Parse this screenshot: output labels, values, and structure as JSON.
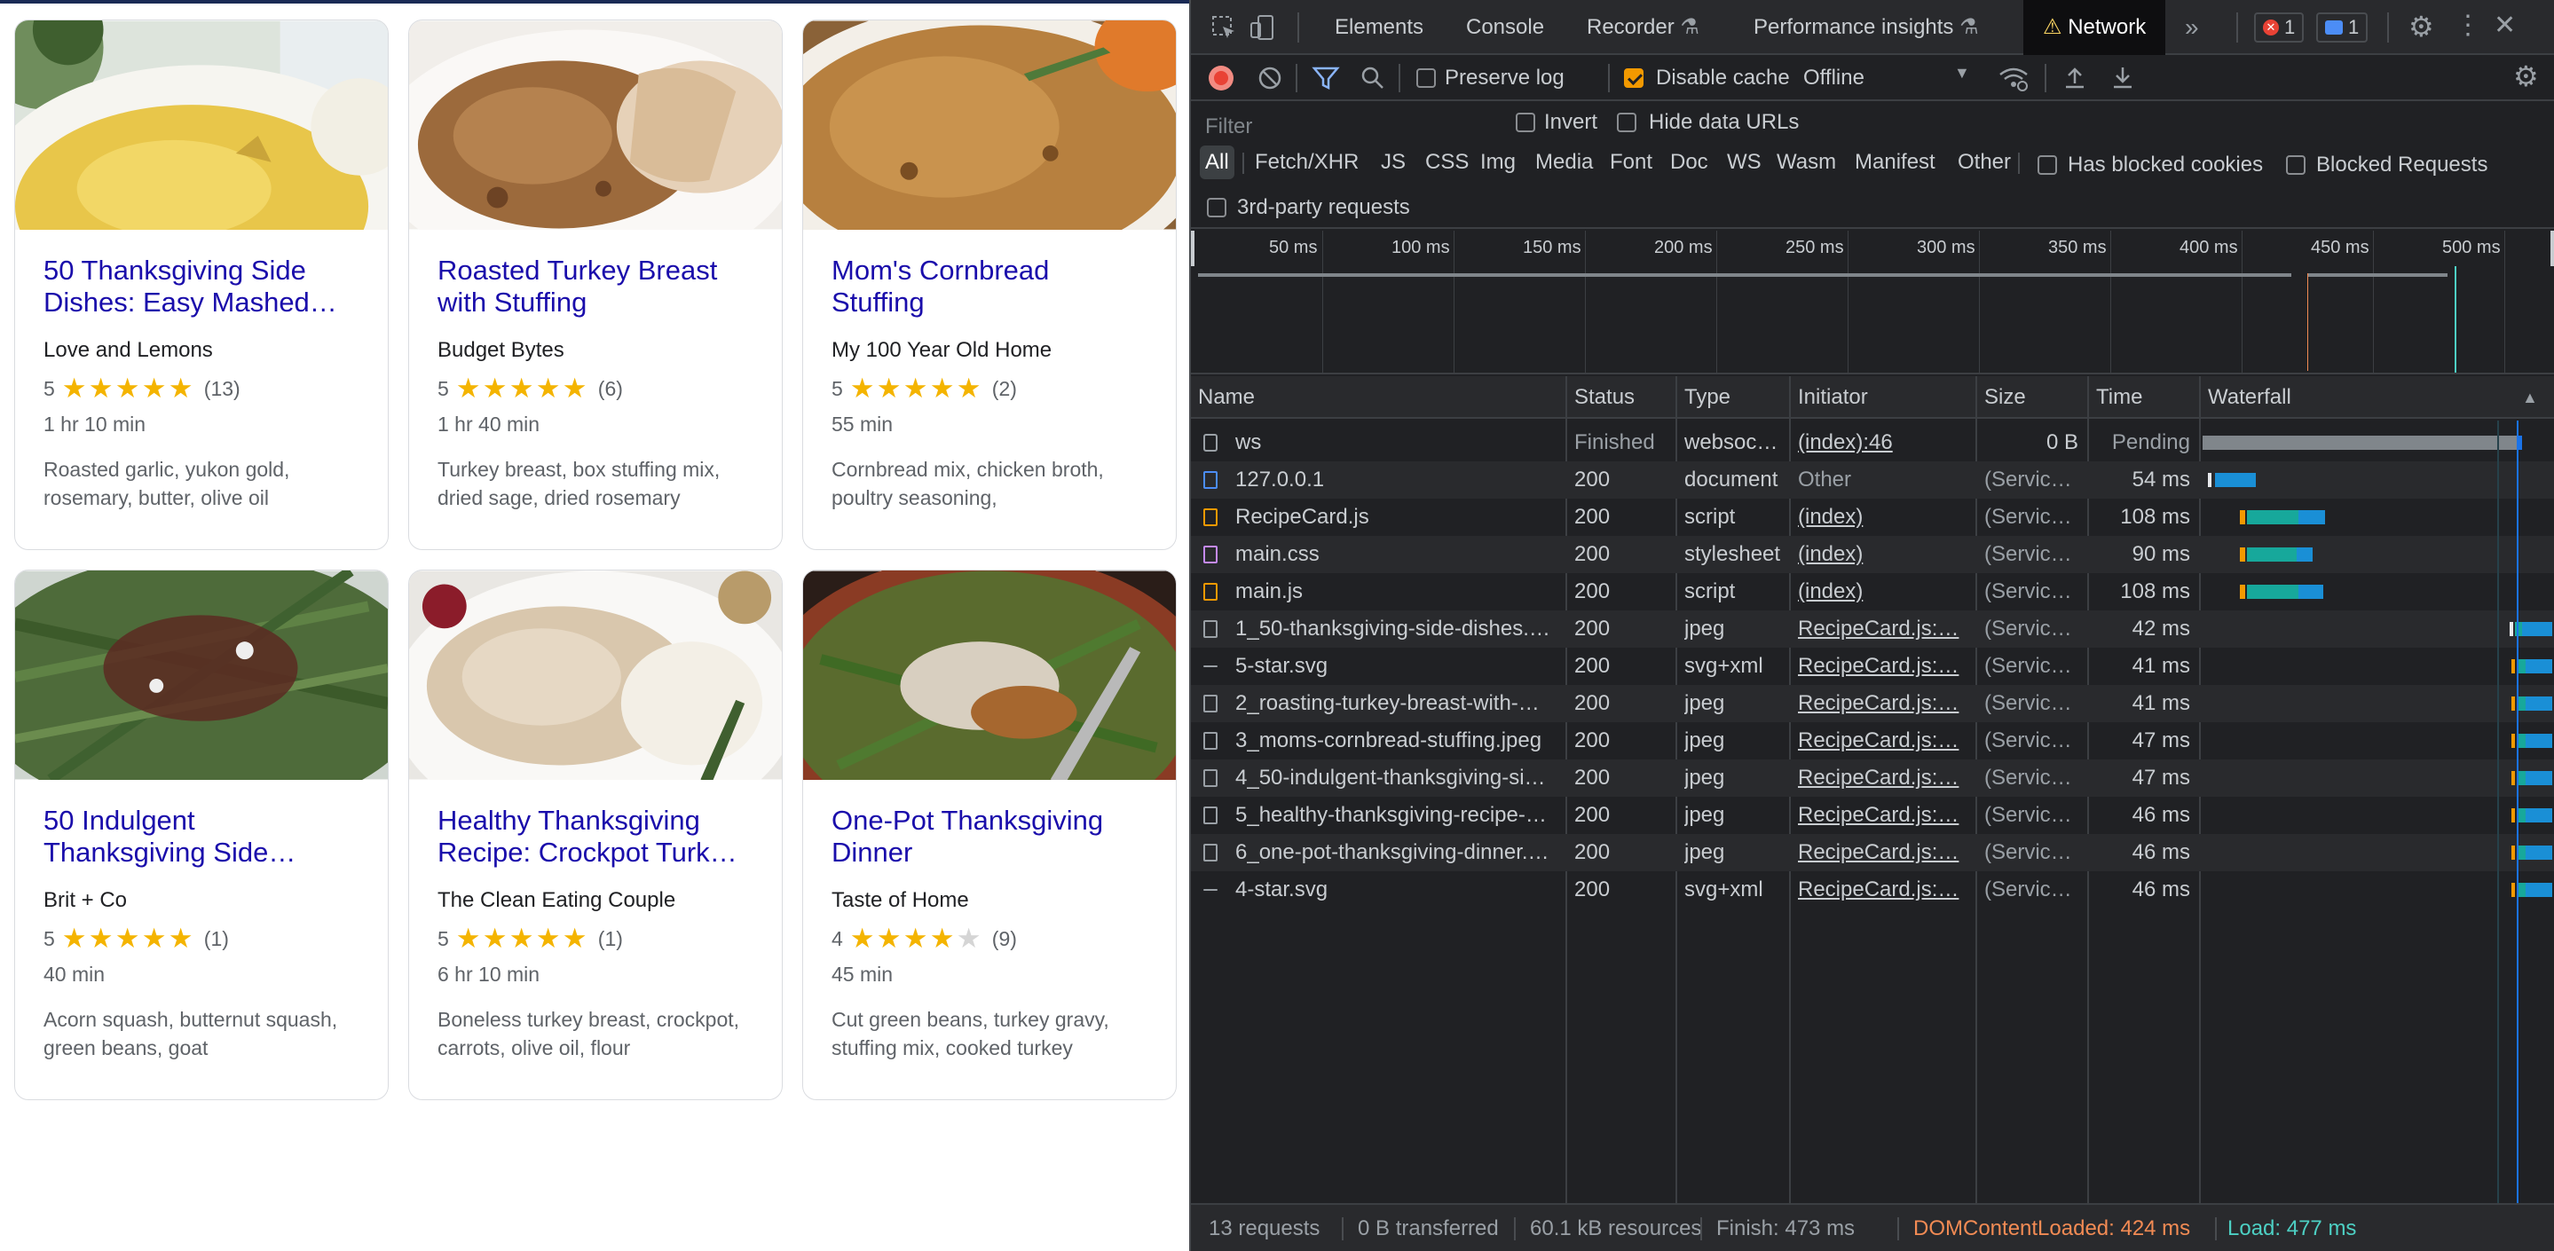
{
  "recipes": [
    {
      "title": "50 Thanksgiving Side Dishes: Easy Mashed…",
      "source": "Love and Lemons",
      "rating": "5",
      "stars": 5,
      "reviews": "(13)",
      "time": "1 hr 10 min",
      "ingredients": "Roasted garlic, yukon gold, rosemary, butter, olive oil"
    },
    {
      "title": "Roasted Turkey Breast with Stuffing",
      "source": "Budget Bytes",
      "rating": "5",
      "stars": 5,
      "reviews": "(6)",
      "time": "1 hr 40 min",
      "ingredients": "Turkey breast, box stuffing mix, dried sage, dried rosemary"
    },
    {
      "title": "Mom's Cornbread Stuffing",
      "source": "My 100 Year Old Home",
      "rating": "5",
      "stars": 5,
      "reviews": "(2)",
      "time": "55 min",
      "ingredients": "Cornbread mix, chicken broth, poultry seasoning,"
    },
    {
      "title": "50 Indulgent Thanksgiving Side…",
      "source": "Brit + Co",
      "rating": "5",
      "stars": 5,
      "reviews": "(1)",
      "time": "40 min",
      "ingredients": "Acorn squash, butternut squash, green beans, goat"
    },
    {
      "title": "Healthy Thanksgiving Recipe: Crockpot Turk…",
      "source": "The Clean Eating Couple",
      "rating": "5",
      "stars": 5,
      "reviews": "(1)",
      "time": "6 hr 10 min",
      "ingredients": "Boneless turkey breast, crockpot, carrots, olive oil, flour"
    },
    {
      "title": "One-Pot Thanksgiving Dinner",
      "source": "Taste of Home",
      "rating": "4",
      "stars": 4,
      "reviews": "(9)",
      "time": "45 min",
      "ingredients": "Cut green beans, turkey gravy, stuffing mix, cooked turkey"
    }
  ],
  "devtools": {
    "tabs": {
      "elements": "Elements",
      "console": "Console",
      "recorder": "Recorder",
      "performance_insights": "Performance insights",
      "network": "Network"
    },
    "badges": {
      "errors": "1",
      "messages": "1"
    },
    "toolbar": {
      "preserve_log": "Preserve log",
      "disable_cache": "Disable cache",
      "throttle": "Offline"
    },
    "filter": {
      "placeholder": "Filter",
      "invert": "Invert",
      "hide_data_urls": "Hide data URLs",
      "has_blocked_cookies": "Has blocked cookies",
      "blocked_requests": "Blocked Requests",
      "third_party": "3rd-party requests"
    },
    "types": [
      "All",
      "Fetch/XHR",
      "JS",
      "CSS",
      "Img",
      "Media",
      "Font",
      "Doc",
      "WS",
      "Wasm",
      "Manifest",
      "Other"
    ],
    "ticks": [
      "50 ms",
      "100 ms",
      "150 ms",
      "200 ms",
      "250 ms",
      "300 ms",
      "350 ms",
      "400 ms",
      "450 ms",
      "500 ms"
    ],
    "columns": {
      "name": "Name",
      "status": "Status",
      "type": "Type",
      "initiator": "Initiator",
      "size": "Size",
      "time": "Time",
      "waterfall": "Waterfall"
    },
    "requests": [
      {
        "name": "ws",
        "status": "Finished",
        "type": "websoc…",
        "initiator": "(index):46",
        "size": "0 B",
        "time": "Pending",
        "icon": "websocket-icon"
      },
      {
        "name": "127.0.0.1",
        "status": "200",
        "type": "document",
        "initiator": "Other",
        "size": "(Servic…",
        "time": "54 ms",
        "icon": "document-icon"
      },
      {
        "name": "RecipeCard.js",
        "status": "200",
        "type": "script",
        "initiator": "(index)",
        "size": "(Servic…",
        "time": "108 ms",
        "icon": "script-icon"
      },
      {
        "name": "main.css",
        "status": "200",
        "type": "stylesheet",
        "initiator": "(index)",
        "size": "(Servic…",
        "time": "90 ms",
        "icon": "stylesheet-icon"
      },
      {
        "name": "main.js",
        "status": "200",
        "type": "script",
        "initiator": "(index)",
        "size": "(Servic…",
        "time": "108 ms",
        "icon": "script-icon"
      },
      {
        "name": "1_50-thanksgiving-side-dishes.…",
        "status": "200",
        "type": "jpeg",
        "initiator": "RecipeCard.js:…",
        "size": "(Servic…",
        "time": "42 ms",
        "icon": "image-icon"
      },
      {
        "name": "5-star.svg",
        "status": "200",
        "type": "svg+xml",
        "initiator": "RecipeCard.js:…",
        "size": "(Servic…",
        "time": "41 ms",
        "icon": "svg-icon"
      },
      {
        "name": "2_roasting-turkey-breast-with-…",
        "status": "200",
        "type": "jpeg",
        "initiator": "RecipeCard.js:…",
        "size": "(Servic…",
        "time": "41 ms",
        "icon": "image-icon"
      },
      {
        "name": "3_moms-cornbread-stuffing.jpeg",
        "status": "200",
        "type": "jpeg",
        "initiator": "RecipeCard.js:…",
        "size": "(Servic…",
        "time": "47 ms",
        "icon": "image-icon"
      },
      {
        "name": "4_50-indulgent-thanksgiving-si…",
        "status": "200",
        "type": "jpeg",
        "initiator": "RecipeCard.js:…",
        "size": "(Servic…",
        "time": "47 ms",
        "icon": "image-icon"
      },
      {
        "name": "5_healthy-thanksgiving-recipe-…",
        "status": "200",
        "type": "jpeg",
        "initiator": "RecipeCard.js:…",
        "size": "(Servic…",
        "time": "46 ms",
        "icon": "image-icon"
      },
      {
        "name": "6_one-pot-thanksgiving-dinner.…",
        "status": "200",
        "type": "jpeg",
        "initiator": "RecipeCard.js:…",
        "size": "(Servic…",
        "time": "46 ms",
        "icon": "image-icon"
      },
      {
        "name": "4-star.svg",
        "status": "200",
        "type": "svg+xml",
        "initiator": "RecipeCard.js:…",
        "size": "(Servic…",
        "time": "46 ms",
        "icon": "svg-icon"
      }
    ],
    "summary": {
      "requests": "13 requests",
      "transferred": "0 B transferred",
      "resources": "60.1 kB resources",
      "finish": "Finish: 473 ms",
      "dom": "DOMContentLoaded: 424 ms",
      "load": "Load: 477 ms"
    },
    "colors": {
      "dom": "#f28b54",
      "load": "#4dd0c4",
      "accent": "#f29900",
      "error": "#e94235",
      "info": "#4c8df6"
    }
  }
}
